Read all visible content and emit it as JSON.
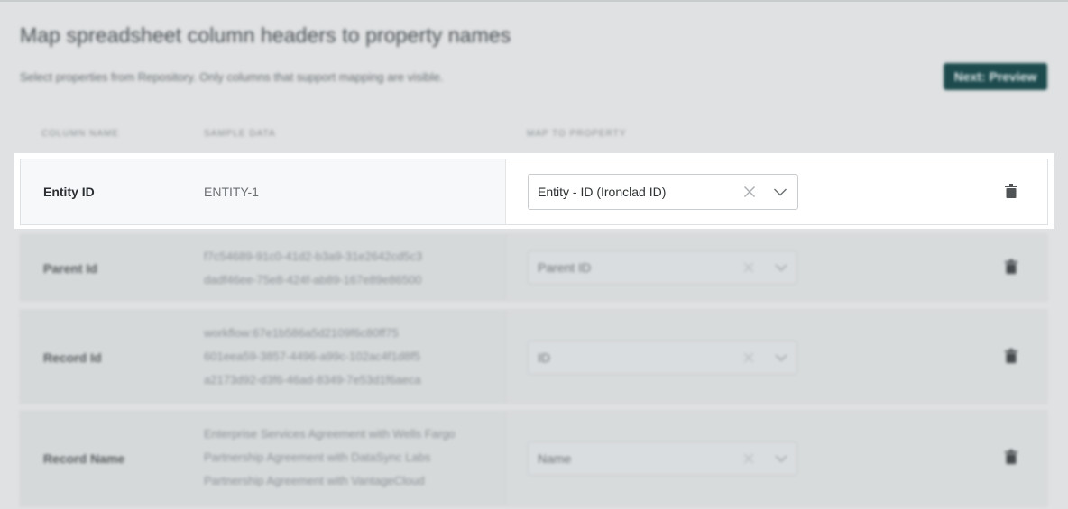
{
  "header": {
    "title": "Map spreadsheet column headers to property names",
    "subtitle": "Select properties from Repository. Only columns that support mapping are visible.",
    "next_button": "Next: Preview"
  },
  "columns": {
    "column_name": "COLUMN NAME",
    "sample_data": "SAMPLE DATA",
    "map_to_property": "MAP TO PROPERTY"
  },
  "rows": [
    {
      "name": "Entity ID",
      "samples": [
        "ENTITY-1"
      ],
      "property": "Entity - ID (Ironclad ID)"
    },
    {
      "name": "Parent Id",
      "samples": [
        "f7c54689-91c0-41d2-b3a9-31e2642cd5c3",
        "dadf46ee-75e8-424f-ab89-167e89e86500"
      ],
      "property": "Parent ID"
    },
    {
      "name": "Record Id",
      "samples": [
        "workflow:67e1b586a5d2109f6c80ff75",
        "601eea59-3857-4496-a99c-102ac4f1d8f5",
        "a2173d92-d3f6-46ad-8349-7e53d1f6aeca"
      ],
      "property": "ID"
    },
    {
      "name": "Record Name",
      "samples": [
        "Enterprise Services Agreement with Wells Fargo",
        "Partnership Agreement with DataSync Labs",
        "Partnership Agreement with VantageCloud"
      ],
      "property": "Name"
    }
  ],
  "icons": {
    "clear": "close-icon",
    "dropdown": "chevron-down-icon",
    "delete": "trash-icon"
  },
  "colors": {
    "primary_button": "#1c4a4d"
  }
}
